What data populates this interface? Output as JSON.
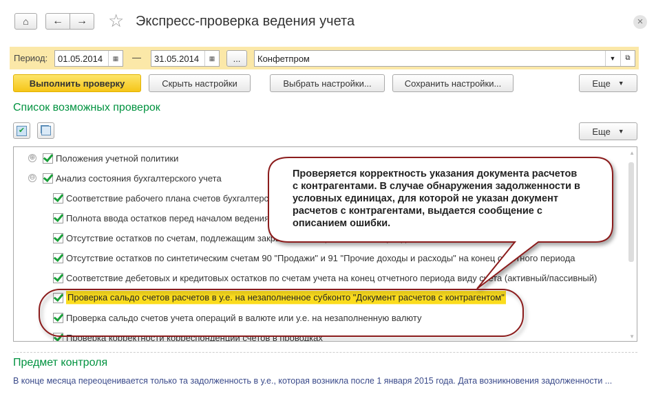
{
  "window": {
    "title": "Экспресс-проверка ведения учета",
    "close": "×"
  },
  "nav": {
    "home_icon": "home-icon",
    "back": "←",
    "forward": "→",
    "star": "☆"
  },
  "filter": {
    "period_label": "Период:",
    "date_from": "01.05.2014",
    "dash": "—",
    "date_to": "31.05.2014",
    "dots": "...",
    "organization": "Конфетпром"
  },
  "toolbar": {
    "run": "Выполнить проверку",
    "hide": "Скрыть настройки",
    "choose": "Выбрать настройки...",
    "save": "Сохранить настройки...",
    "more": "Еще"
  },
  "checks": {
    "title": "Список возможных проверок",
    "more": "Еще",
    "items": [
      {
        "label": "Положения учетной политики",
        "level": 0,
        "expander": "⊕"
      },
      {
        "label": "Анализ состояния бухгалтерского учета",
        "level": 0,
        "expander": "⊖"
      },
      {
        "label": "Соответствие рабочего плана счетов бухгалтерского учета",
        "level": 1
      },
      {
        "label": "Полнота ввода остатков перед началом ведения учета",
        "level": 1
      },
      {
        "label": "Отсутствие остатков по счетам, подлежащим закрытию в конце отчетного периода",
        "level": 1
      },
      {
        "label": "Отсутствие остатков по синтетическим счетам 90 \"Продажи\" и 91 \"Прочие доходы и расходы\" на конец отчетного периода",
        "level": 1
      },
      {
        "label": "Соответствие дебетовых и кредитовых остатков по счетам учета на конец отчетного периода виду счета (активный/пассивный)",
        "level": 1
      },
      {
        "label": "Проверка сальдо счетов расчетов в у.е. на незаполненное субконто \"Документ расчетов с контрагентом\"",
        "level": 1,
        "selected": true
      },
      {
        "label": "Проверка сальдо счетов учета операций в валюте или у.е. на незаполненную валюту",
        "level": 1
      },
      {
        "label": "Проверка корректности корреспонденции счетов в проводках",
        "level": 1
      }
    ]
  },
  "callout": {
    "text": "Проверяется корректность указания документа расчетов с контрагентами. В случае обнаружения задолженности в условных единицах, для которой не указан документ расчетов с контрагентами, выдается сообщение с описанием ошибки."
  },
  "control": {
    "title": "Предмет контроля",
    "text": "В конце месяца переоценивается только та задолженность в у.е., которая возникла после 1 января 2015 года. Дата возникновения задолженности ..."
  },
  "colors": {
    "accent_green": "#00923f",
    "highlight": "#fbdc1e",
    "callout_border": "#8b1a1a"
  }
}
